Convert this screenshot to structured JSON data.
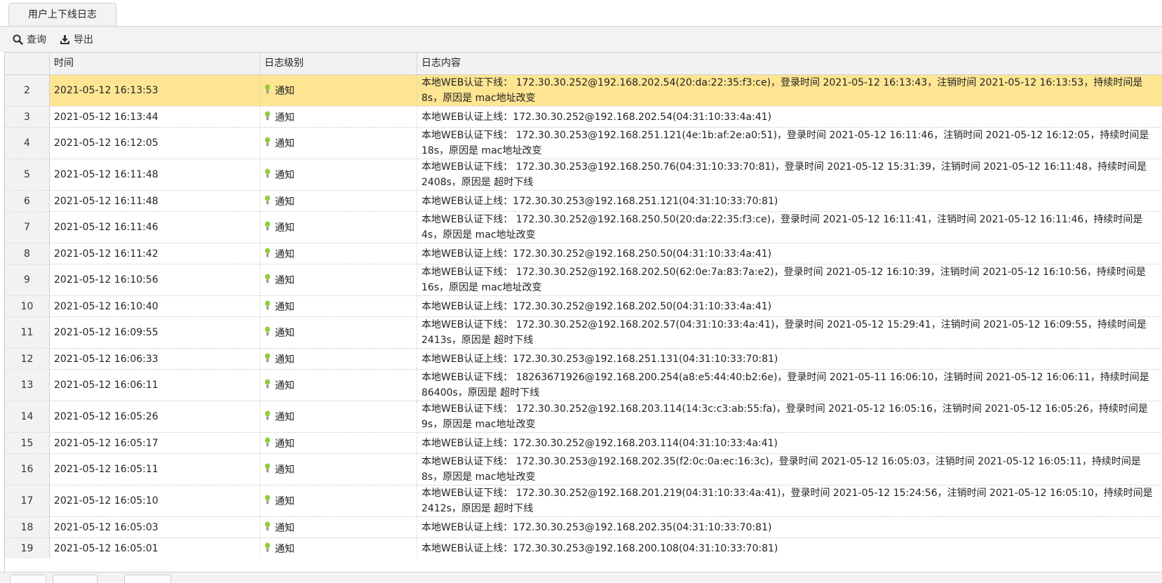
{
  "tab": {
    "title": "用户上下线日志"
  },
  "toolbar": {
    "query_label": "查询",
    "export_label": "导出"
  },
  "table": {
    "columns": [
      "时间",
      "日志级别",
      "日志内容"
    ],
    "rows": [
      {
        "num": "2",
        "time": "2021-05-12 16:13:53",
        "level": "通知",
        "msg": "本地WEB认证下线： 172.30.30.252@192.168.202.54(20:da:22:35:f3:ce)，登录时间 2021-05-12 16:13:43，注销时间 2021-05-12 16:13:53，持续时间是 8s，原因是 mac地址改变",
        "selected": true
      },
      {
        "num": "3",
        "time": "2021-05-12 16:13:44",
        "level": "通知",
        "msg": "本地WEB认证上线：172.30.30.252@192.168.202.54(04:31:10:33:4a:41)"
      },
      {
        "num": "4",
        "time": "2021-05-12 16:12:05",
        "level": "通知",
        "msg": "本地WEB认证下线： 172.30.30.253@192.168.251.121(4e:1b:af:2e:a0:51)，登录时间 2021-05-12 16:11:46，注销时间 2021-05-12 16:12:05，持续时间是 18s，原因是 mac地址改变"
      },
      {
        "num": "5",
        "time": "2021-05-12 16:11:48",
        "level": "通知",
        "msg": "本地WEB认证下线： 172.30.30.253@192.168.250.76(04:31:10:33:70:81)，登录时间 2021-05-12 15:31:39，注销时间 2021-05-12 16:11:48，持续时间是 2408s，原因是 超时下线"
      },
      {
        "num": "6",
        "time": "2021-05-12 16:11:48",
        "level": "通知",
        "msg": "本地WEB认证上线：172.30.30.253@192.168.251.121(04:31:10:33:70:81)"
      },
      {
        "num": "7",
        "time": "2021-05-12 16:11:46",
        "level": "通知",
        "msg": "本地WEB认证下线： 172.30.30.252@192.168.250.50(20:da:22:35:f3:ce)，登录时间 2021-05-12 16:11:41，注销时间 2021-05-12 16:11:46，持续时间是 4s，原因是 mac地址改变"
      },
      {
        "num": "8",
        "time": "2021-05-12 16:11:42",
        "level": "通知",
        "msg": "本地WEB认证上线：172.30.30.252@192.168.250.50(04:31:10:33:4a:41)"
      },
      {
        "num": "9",
        "time": "2021-05-12 16:10:56",
        "level": "通知",
        "msg": "本地WEB认证下线： 172.30.30.252@192.168.202.50(62:0e:7a:83:7a:e2)，登录时间 2021-05-12 16:10:39，注销时间 2021-05-12 16:10:56，持续时间是 16s，原因是 mac地址改变"
      },
      {
        "num": "10",
        "time": "2021-05-12 16:10:40",
        "level": "通知",
        "msg": "本地WEB认证上线：172.30.30.252@192.168.202.50(04:31:10:33:4a:41)"
      },
      {
        "num": "11",
        "time": "2021-05-12 16:09:55",
        "level": "通知",
        "msg": "本地WEB认证下线： 172.30.30.252@192.168.202.57(04:31:10:33:4a:41)，登录时间 2021-05-12 15:29:41，注销时间 2021-05-12 16:09:55，持续时间是 2413s，原因是 超时下线"
      },
      {
        "num": "12",
        "time": "2021-05-12 16:06:33",
        "level": "通知",
        "msg": "本地WEB认证上线：172.30.30.253@192.168.251.131(04:31:10:33:70:81)"
      },
      {
        "num": "13",
        "time": "2021-05-12 16:06:11",
        "level": "通知",
        "msg": "本地WEB认证下线： 18263671926@192.168.200.254(a8:e5:44:40:b2:6e)，登录时间 2021-05-11 16:06:10，注销时间 2021-05-12 16:06:11，持续时间是 86400s，原因是 超时下线"
      },
      {
        "num": "14",
        "time": "2021-05-12 16:05:26",
        "level": "通知",
        "msg": "本地WEB认证下线： 172.30.30.252@192.168.203.114(14:3c:c3:ab:55:fa)，登录时间 2021-05-12 16:05:16，注销时间 2021-05-12 16:05:26，持续时间是 9s，原因是 mac地址改变"
      },
      {
        "num": "15",
        "time": "2021-05-12 16:05:17",
        "level": "通知",
        "msg": "本地WEB认证上线：172.30.30.252@192.168.203.114(04:31:10:33:4a:41)"
      },
      {
        "num": "16",
        "time": "2021-05-12 16:05:11",
        "level": "通知",
        "msg": "本地WEB认证下线： 172.30.30.253@192.168.202.35(f2:0c:0a:ec:16:3c)，登录时间 2021-05-12 16:05:03，注销时间 2021-05-12 16:05:11，持续时间是 8s，原因是 mac地址改变"
      },
      {
        "num": "17",
        "time": "2021-05-12 16:05:10",
        "level": "通知",
        "msg": "本地WEB认证下线： 172.30.30.252@192.168.201.219(04:31:10:33:4a:41)，登录时间 2021-05-12 15:24:56，注销时间 2021-05-12 16:05:10，持续时间是 2412s，原因是 超时下线"
      },
      {
        "num": "18",
        "time": "2021-05-12 16:05:03",
        "level": "通知",
        "msg": "本地WEB认证上线：172.30.30.253@192.168.202.35(04:31:10:33:70:81)"
      },
      {
        "num": "19",
        "time": "2021-05-12 16:05:01",
        "level": "通知",
        "msg": "本地WEB认证上线：172.30.30.253@192.168.200.108(04:31:10:33:70:81)"
      }
    ]
  },
  "colors": {
    "selected_row": "#fde592",
    "header_bg": "#f2f2f2",
    "bulb_icon": "#8fcf3a"
  },
  "icons": {
    "query": "search-icon",
    "export": "download-icon",
    "level": "bulb-icon"
  }
}
